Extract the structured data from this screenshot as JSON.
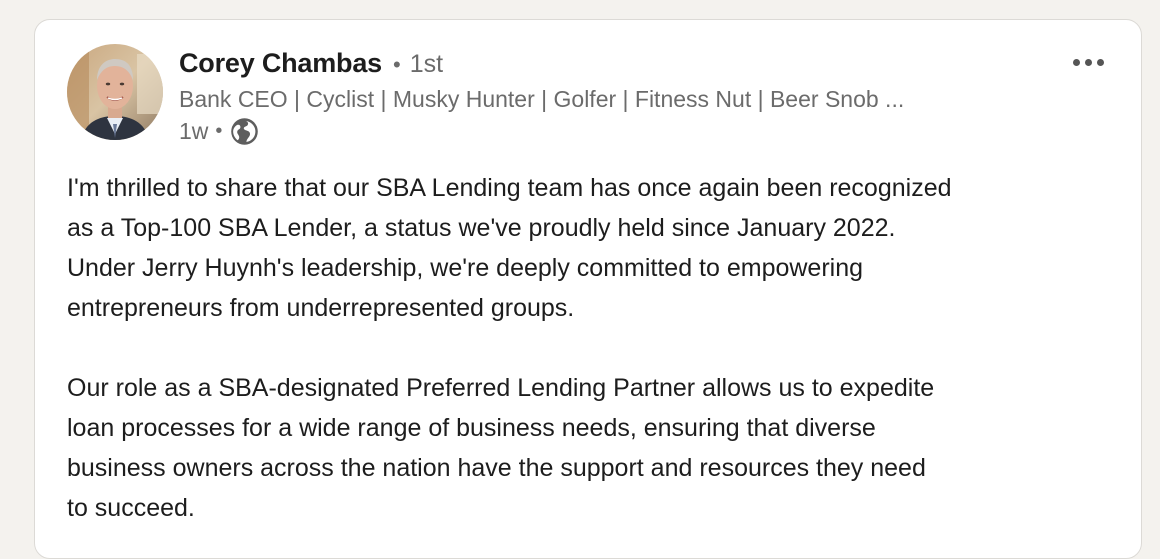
{
  "post": {
    "author": {
      "name": "Corey Chambas",
      "connection_degree": "1st",
      "headline": "Bank CEO | Cyclist | Musky Hunter | Golfer | Fitness Nut | Beer Snob ...",
      "avatar_icon": "person-photo",
      "time_ago": "1w",
      "visibility_icon": "globe-icon"
    },
    "menu_icon": "more-horizontal-icon",
    "body": {
      "paragraph1_lines": [
        "I'm thrilled to share that our SBA Lending team has once again been recognized",
        "as a Top-100 SBA Lender, a status we've proudly held since January 2022.",
        "Under Jerry Huynh's leadership, we're deeply committed to empowering",
        "entrepreneurs from underrepresented groups."
      ],
      "paragraph2_lines": [
        "Our role as a SBA-designated Preferred Lending Partner allows us to expedite",
        "loan processes for a wide range of business needs, ensuring that diverse",
        "business owners across the nation have the support and resources they need",
        "to succeed."
      ]
    }
  },
  "colors": {
    "page_background": "#f4f2ee",
    "card_background": "#ffffff",
    "primary_text": "#1d1d1d",
    "secondary_text": "#6b6b6b"
  }
}
